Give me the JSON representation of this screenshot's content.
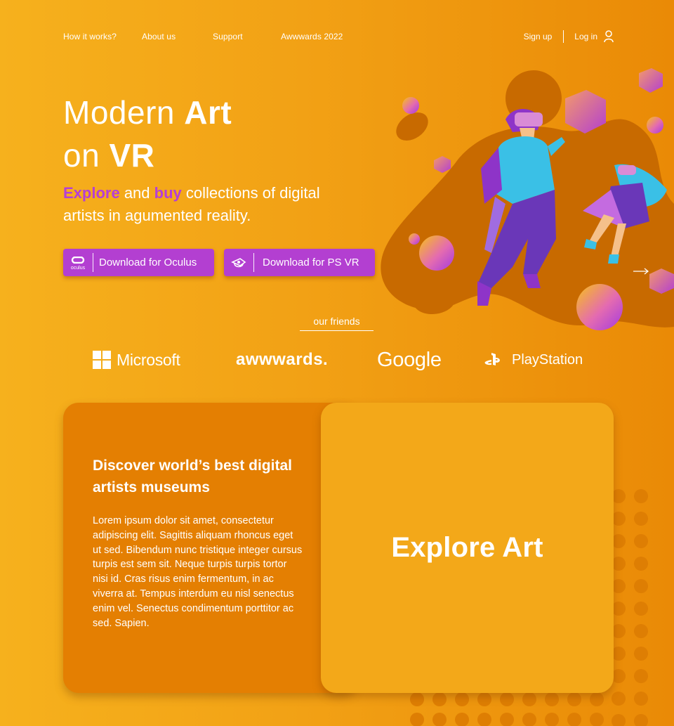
{
  "nav": {
    "links": [
      "How it works?",
      "About us",
      "Support",
      "Awwwards 2022"
    ],
    "sign_up": "Sign up",
    "log_in": "Log in",
    "user_icon": "user-icon"
  },
  "hero": {
    "title_line1_regular": "Modern ",
    "title_line1_bold": "Art",
    "title_line2_regular": "on ",
    "title_line2_bold": "VR",
    "sub_explore": "Explore",
    "sub_and": " and ",
    "sub_buy": "buy",
    "sub_rest": " collections of digital artists in agumented reality."
  },
  "buttons": {
    "oculus_label": "Download for Oculus",
    "oculus_icon_text": "oculus",
    "psvr_label": "Download for PS VR"
  },
  "friends": {
    "label": "our friends",
    "logos": [
      "Microsoft",
      "awwwards.",
      "Google",
      "PlayStation"
    ]
  },
  "card": {
    "title": "Discover world’s best digital artists museums",
    "body": "Lorem ipsum dolor sit amet, consectetur adipiscing elit. Sagittis aliquam rhoncus eget ut sed. Bibendum nunc tristique integer cursus turpis est sem sit. Neque turpis turpis tortor nisi id. Cras risus enim fermentum, in ac viverra at. Tempus interdum eu nisl senectus enim vel. Senectus condimentum porttitor ac sed. Sapien.",
    "cta": "Explore Art"
  },
  "colors": {
    "accent_purple": "#b33fd1",
    "card_dark": "#e47f02",
    "card_light": "#f3a819",
    "background_start": "#f6b11d",
    "background_end": "#ea8a06"
  }
}
